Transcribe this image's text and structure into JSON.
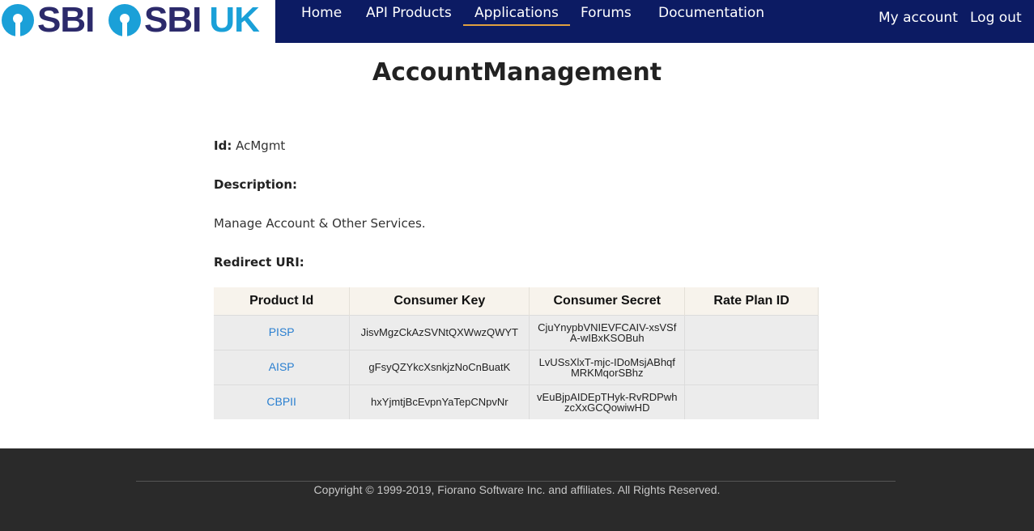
{
  "header": {
    "logos": [
      {
        "brand": "SBI",
        "suffix": ""
      },
      {
        "brand": "SBI",
        "suffix": "UK"
      }
    ],
    "nav": [
      {
        "label": "Home",
        "active": false
      },
      {
        "label": "API Products",
        "active": false
      },
      {
        "label": "Applications",
        "active": true
      },
      {
        "label": "Forums",
        "active": false
      },
      {
        "label": "Documentation",
        "active": false
      }
    ],
    "right": {
      "my_account": "My account",
      "log_out": "Log out"
    },
    "colors": {
      "bar": "#0c1b63",
      "active_underline": "#e0a040",
      "logo_text": "#2c2a6b",
      "logo_accent": "#1aa0d8"
    }
  },
  "app": {
    "title": "AccountManagement",
    "id_label": "Id:",
    "id_value": "AcMgmt",
    "description_label": "Description:",
    "description": "Manage Account & Other Services.",
    "redirect_label": "Redirect URI:",
    "redirect_value": ""
  },
  "table": {
    "headers": [
      "Product Id",
      "Consumer Key",
      "Consumer Secret",
      "Rate Plan ID"
    ],
    "rows": [
      {
        "product": "PISP",
        "key": "JisvMgzCkAzSVNtQXWwzQWYT",
        "secret": "CjuYnypbVNIEVFCAIV-xsVSfA-wIBxKSOBuh",
        "rate_plan": ""
      },
      {
        "product": "AISP",
        "key": "gFsyQZYkcXsnkjzNoCnBuatK",
        "secret": "LvUSsXlxT-mjc-IDoMsjABhqfMRKMqorSBhz",
        "rate_plan": ""
      },
      {
        "product": "CBPII",
        "key": "hxYjmtjBcEvpnYaTepCNpvNr",
        "secret": "vEuBjpAIDEpTHyk-RvRDPwhzcXxGCQowiwHD",
        "rate_plan": ""
      }
    ]
  },
  "footer": {
    "copyright": "Copyright © 1999-2019, Fiorano Software Inc. and affiliates. All Rights Reserved."
  }
}
